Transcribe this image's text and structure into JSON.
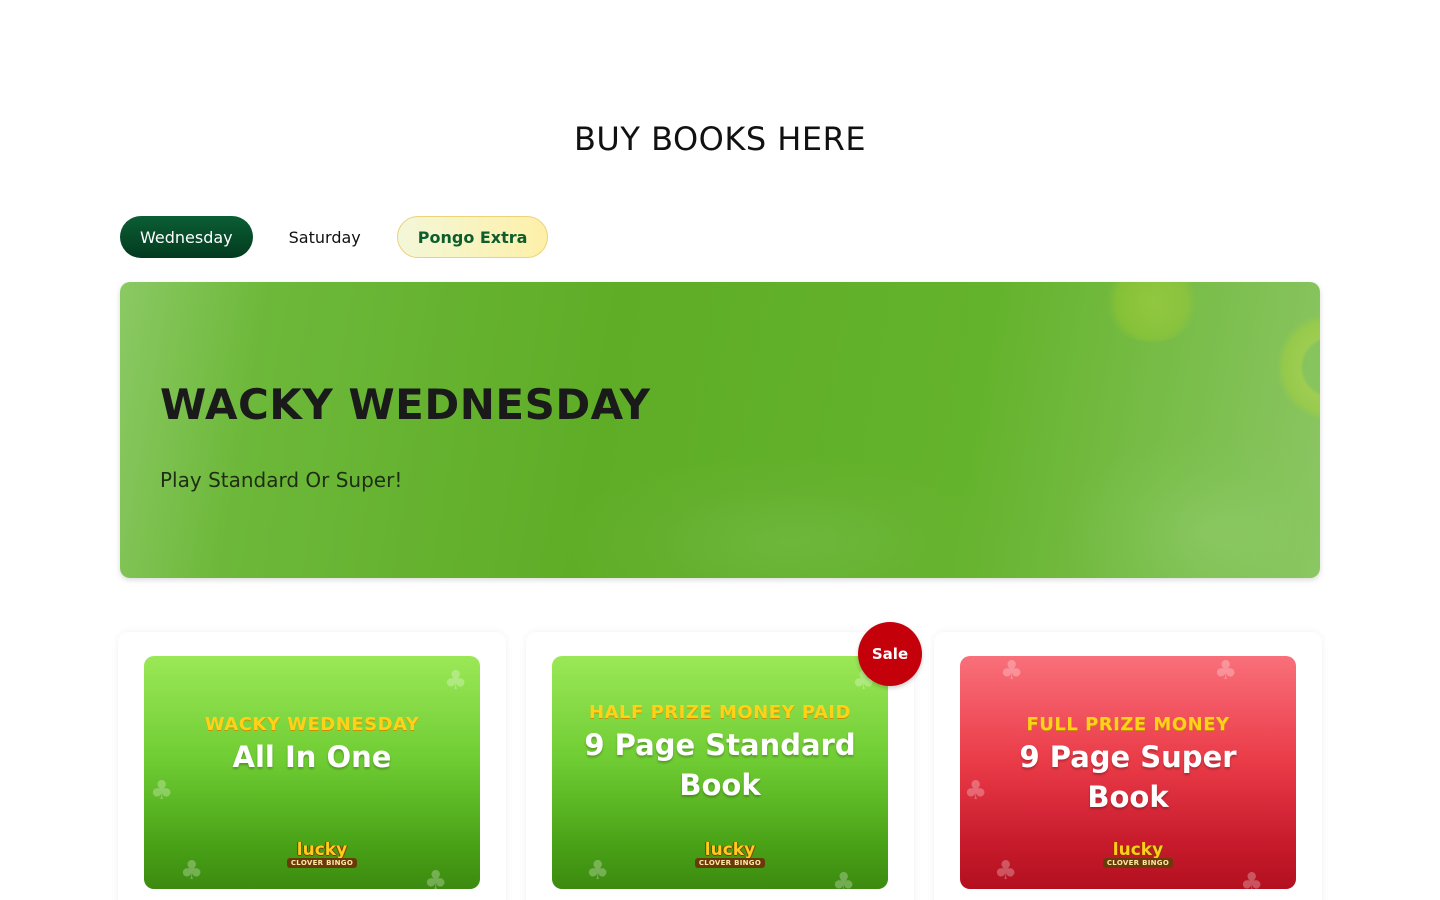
{
  "page": {
    "title": "BUY BOOKS HERE"
  },
  "tabs": [
    {
      "label": "Wednesday",
      "active": true
    },
    {
      "label": "Saturday",
      "active": false
    },
    {
      "label": "Pongo Extra",
      "active": false
    }
  ],
  "hero": {
    "title": "WACKY WEDNESDAY",
    "subtitle": "Play Standard Or Super!"
  },
  "cards": [
    {
      "kicker": "WACKY WEDNESDAY",
      "heading": "All In One",
      "theme": "green",
      "logo": "lucky",
      "logo_sub": "CLOVER BINGO"
    },
    {
      "kicker": "HALF PRIZE MONEY PAID",
      "heading": "9 Page Standard Book",
      "theme": "green",
      "badge": "Sale",
      "logo": "lucky",
      "logo_sub": "CLOVER BINGO"
    },
    {
      "kicker": "FULL PRIZE MONEY",
      "heading": "9 Page Super Book",
      "theme": "red",
      "logo": "lucky",
      "logo_sub": "CLOVER BINGO"
    }
  ],
  "colors": {
    "tab_active": "#0b5e35",
    "hero_green": "#5fad27",
    "sale_red": "#c4000b",
    "kicker_yellow": "#ffd21a"
  },
  "icons": [
    "clover-icon",
    "lucky-clover-bingo-logo"
  ]
}
